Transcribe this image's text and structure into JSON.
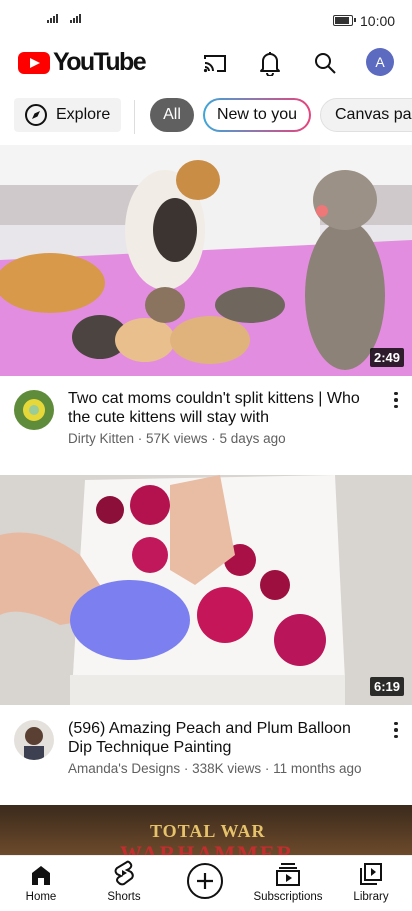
{
  "status_bar": {
    "time": "10:00",
    "battery_level": 0.85
  },
  "header": {
    "logo_text": "YouTube",
    "avatar_letter": "A",
    "colors": {
      "brand": "#ff0000",
      "avatar": "#5c6bc0"
    }
  },
  "chips": {
    "explore_label": "Explore",
    "items": [
      {
        "label": "All",
        "selected": true
      },
      {
        "label": "New to you",
        "selected": false
      },
      {
        "label": "Canvas pai",
        "selected": false
      }
    ]
  },
  "videos": [
    {
      "title": "Two cat moms couldn't split kittens | Who the cute kittens will stay with",
      "subtitle": "Dirty Kitten · 57K views · 5 days ago",
      "duration": "2:49"
    },
    {
      "title": "(596) Amazing Peach and Plum Balloon Dip Technique Painting",
      "subtitle": "Amanda's Designs · 338K views · 11 months ago",
      "duration": "6:19"
    },
    {
      "thumbnail_text": "TOTAL WAR",
      "thumbnail_subtext": "WARHAMMER"
    }
  ],
  "bottom_nav": {
    "items": [
      {
        "label": "Home",
        "icon": "home-icon"
      },
      {
        "label": "Shorts",
        "icon": "shorts-icon"
      },
      {
        "label": "Subscriptions",
        "icon": "subscriptions-icon"
      },
      {
        "label": "Library",
        "icon": "library-icon"
      }
    ],
    "create_icon": "create-plus-icon"
  }
}
